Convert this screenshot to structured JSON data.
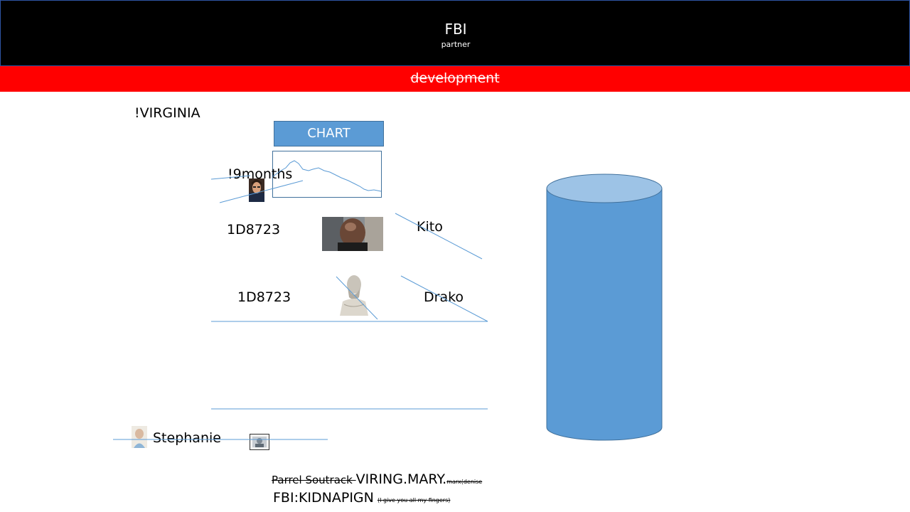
{
  "header": {
    "title": "FBI",
    "subtitle": "partner"
  },
  "banner": {
    "text": "development"
  },
  "labels": {
    "virginia": "!VIRGINIA",
    "chart_button": "CHART",
    "nine_months": "!9months",
    "code_1": "1D8723",
    "code_2": "1D8723",
    "kito": "Kito",
    "drako": "Drako",
    "stephanie": "Stephanie"
  },
  "footer": {
    "line1_strike": "Parrel Soutrack ",
    "line1_main": "VIRING.MARY.",
    "line1_small": "marx(denise",
    "line2_main": "FBI:KIDNAPIGN",
    "line2_small": "(I give you all my fingers)"
  },
  "colors": {
    "header_bg": "#000000",
    "banner_bg": "#ff0000",
    "accent": "#5b9bd5",
    "line": "#5b9bd5"
  }
}
